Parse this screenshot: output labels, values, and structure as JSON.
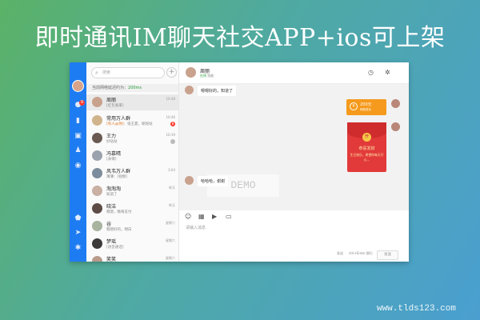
{
  "headline": "即时通讯IM聊天社交APP+ios可上架",
  "footer_url": "www.tlds123.com",
  "colors": {
    "rail": "#1e7cf2",
    "transfer": "#f59a1c",
    "red_packet": "#e23a3a",
    "online": "#2a9d3a"
  },
  "search": {
    "placeholder": "搜索"
  },
  "latency": {
    "label": "当前网络延迟约为：",
    "value": "200ms"
  },
  "conversations": [
    {
      "name": "周丽",
      "preview": "[红包发来]",
      "tag": "",
      "time": "10:48"
    },
    {
      "name": "常用万人群",
      "preview": "：张王夏，呢呢哒",
      "tag": "[有人@你]",
      "time": "10:46",
      "badge": "8"
    },
    {
      "name": "王力",
      "preview": "好哒哒",
      "tag": "",
      "time": "10:39"
    },
    {
      "name": "冯慕晴",
      "preview": "[表情]",
      "tag": "",
      "time": ""
    },
    {
      "name": "风韦万人群",
      "preview": "薄薄：[视频]",
      "tag": "",
      "time": "3:04"
    },
    {
      "name": "淘淘淘",
      "preview": "知道了",
      "tag": "",
      "time": "昨天"
    },
    {
      "name": "晓洁",
      "preview": "嗯嗯，晚每支付",
      "tag": "",
      "time": "昨天"
    },
    {
      "name": "谷",
      "preview": "嗯嗯好的，明白",
      "tag": "",
      "time": "星期六"
    },
    {
      "name": "梦瑶",
      "preview": "[语音通话]",
      "tag": "",
      "time": "星期六"
    },
    {
      "name": "笑笑",
      "preview": "",
      "tag": "",
      "time": "星期六"
    }
  ],
  "chat": {
    "name": "周丽",
    "status": "在线",
    "status_extra": "别能",
    "messages": {
      "m1": "嗯嗯好的，知道了",
      "transfer_amount": "200元",
      "transfer_label": "转账成功",
      "red_title": "恭喜发财",
      "red_sub": "生日快乐，希望你每天开心...",
      "red_seal": "开",
      "m2": "哈哈哈，谢谢"
    },
    "watermark": "DEMO",
    "input_placeholder": "请输入消息",
    "hint_send": "发送",
    "hint_newline": "ctrl+Enter 换行",
    "send_button": "发送"
  }
}
